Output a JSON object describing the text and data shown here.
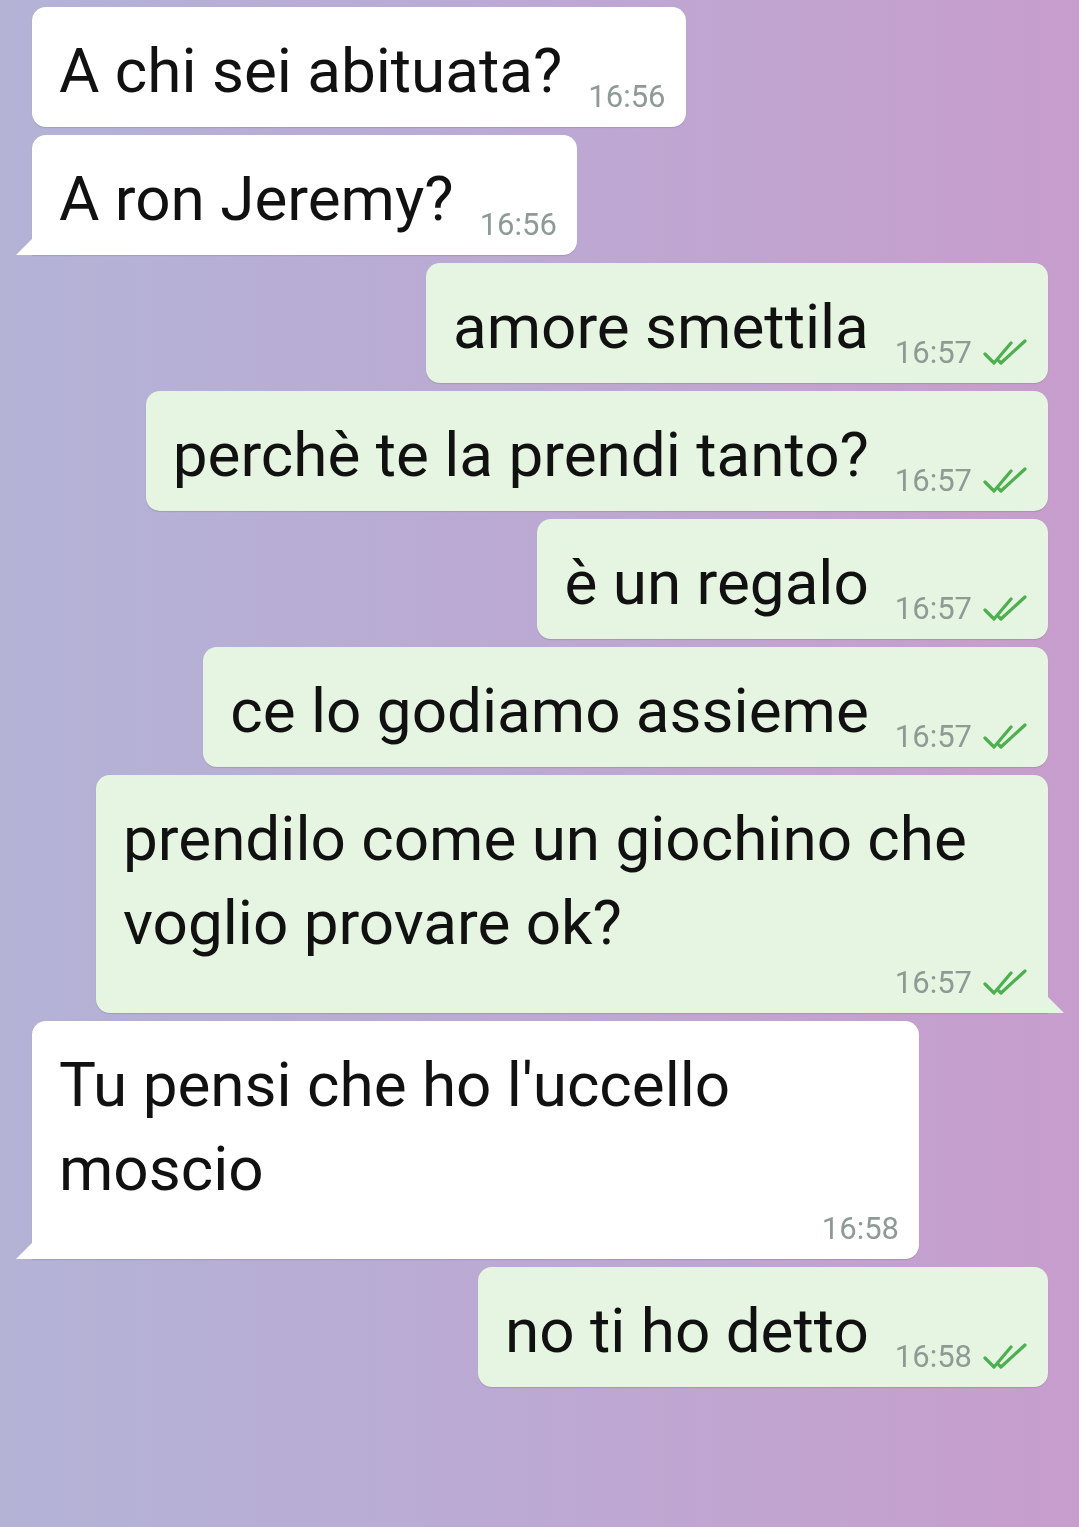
{
  "messages": [
    {
      "kind": "incoming",
      "text": "A chi sei abituata?",
      "time": "16:56",
      "tail": false
    },
    {
      "kind": "incoming",
      "text": "A ron Jeremy?",
      "time": "16:56",
      "tail": true
    },
    {
      "kind": "outgoing",
      "text": "amore smettila",
      "time": "16:57",
      "tail": false,
      "read": true
    },
    {
      "kind": "outgoing",
      "text": "perchè te la prendi tanto?",
      "time": "16:57",
      "tail": false,
      "read": true
    },
    {
      "kind": "outgoing",
      "text": "è un regalo",
      "time": "16:57",
      "tail": false,
      "read": true
    },
    {
      "kind": "outgoing",
      "text": "ce lo godiamo assieme",
      "time": "16:57",
      "tail": false,
      "read": true
    },
    {
      "kind": "outgoing",
      "text": "prendilo come un giochino che voglio provare ok?",
      "time": "16:57",
      "tail": true,
      "read": true
    },
    {
      "kind": "incoming",
      "text": "Tu pensi che ho l'uccello moscio",
      "time": "16:58",
      "tail": true
    },
    {
      "kind": "outgoing",
      "text": "no ti ho detto",
      "time": "16:58",
      "tail": false,
      "read": true
    }
  ]
}
